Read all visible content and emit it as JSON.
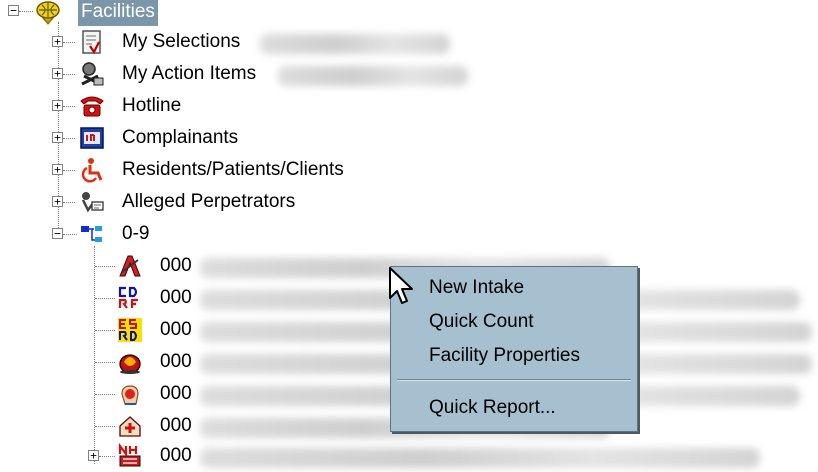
{
  "tree": {
    "root": {
      "label": "Facilities",
      "icon": "facility-globe-icon",
      "expanded": true
    },
    "children": [
      {
        "label": "My Selections",
        "icon": "selections-document-icon",
        "expanded": false
      },
      {
        "label": "My Action Items",
        "icon": "action-items-icon",
        "expanded": false
      },
      {
        "label": "Hotline",
        "icon": "telephone-icon",
        "expanded": false
      },
      {
        "label": "Complainants",
        "icon": "complainants-card-icon",
        "expanded": false
      },
      {
        "label": "Residents/Patients/Clients",
        "icon": "wheelchair-icon",
        "expanded": false
      },
      {
        "label": "Alleged Perpetrators",
        "icon": "perpetrators-icon",
        "expanded": false
      },
      {
        "label": "0-9",
        "icon": "group-tree-icon",
        "expanded": true
      }
    ],
    "group_items": [
      {
        "prefix": "000",
        "icon": "facility-type-a-icon"
      },
      {
        "prefix": "000",
        "icon": "facility-type-cd-rf-icon"
      },
      {
        "prefix": "000",
        "icon": "facility-type-es-rd-icon"
      },
      {
        "prefix": "000",
        "icon": "facility-type-fire-icon"
      },
      {
        "prefix": "000",
        "icon": "facility-type-hand-icon"
      },
      {
        "prefix": "000",
        "icon": "facility-type-cross-icon"
      },
      {
        "prefix": "000",
        "icon": "facility-type-nh-icon"
      }
    ]
  },
  "context_menu": {
    "items": [
      {
        "label": "New Intake"
      },
      {
        "label": "Quick Count"
      },
      {
        "label": "Facility Properties"
      },
      {
        "label": "Quick Report..."
      }
    ]
  },
  "colors": {
    "selection": "#7a96a8",
    "menu_bg": "#a7c0d0",
    "menu_border": "#5e7484"
  }
}
